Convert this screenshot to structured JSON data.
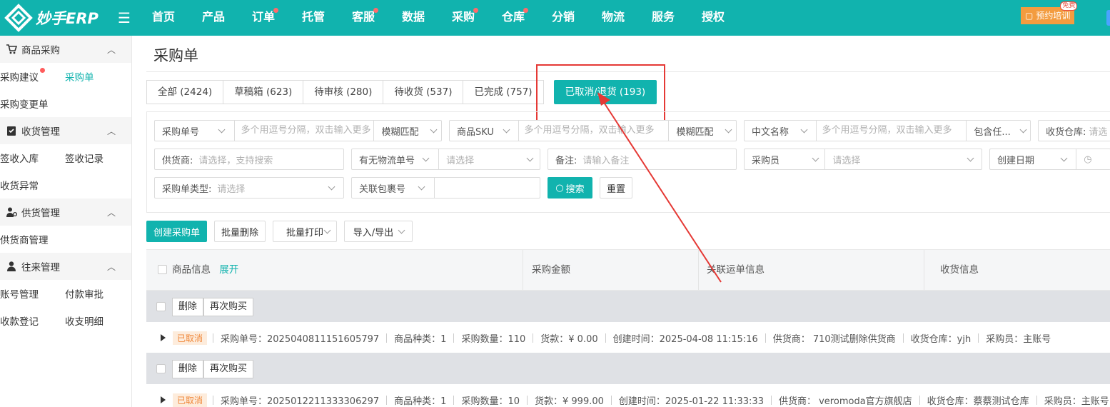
{
  "app": {
    "logo_text": "妙手ERP"
  },
  "nav": [
    {
      "label": "首页",
      "dot": false
    },
    {
      "label": "产品",
      "dot": false
    },
    {
      "label": "订单",
      "dot": true
    },
    {
      "label": "托管",
      "dot": false
    },
    {
      "label": "客服",
      "dot": true
    },
    {
      "label": "数据",
      "dot": false
    },
    {
      "label": "采购",
      "dot": true
    },
    {
      "label": "仓库",
      "dot": true
    },
    {
      "label": "分销",
      "dot": false
    },
    {
      "label": "物流",
      "dot": false
    },
    {
      "label": "服务",
      "dot": false
    },
    {
      "label": "授权",
      "dot": false
    }
  ],
  "header": {
    "training_label": "预约培训",
    "free_badge": "免费"
  },
  "sidebar": {
    "groups": [
      {
        "title": "商品采购",
        "icon": "cart-icon",
        "items": [
          [
            "采购建议",
            "采购单"
          ],
          [
            "采购变更单"
          ]
        ]
      },
      {
        "title": "收货管理",
        "icon": "clipboard-check-icon",
        "items": [
          [
            "签收入库",
            "签收记录"
          ],
          [
            "收货异常"
          ]
        ]
      },
      {
        "title": "供货管理",
        "icon": "supplier-icon",
        "items": [
          [
            "供货商管理"
          ]
        ]
      },
      {
        "title": "往来管理",
        "icon": "user-icon",
        "items": [
          [
            "账号管理",
            "付款审批"
          ],
          [
            "收款登记",
            "收支明细"
          ]
        ]
      }
    ]
  },
  "page": {
    "title": "采购单"
  },
  "tabs": [
    "全部 (2424)",
    "草稿箱 (623)",
    "待审核 (280)",
    "待收货 (537)",
    "已完成 (757)",
    "已取消/退货 (193)"
  ],
  "filters": {
    "po_no_select": "采购单号",
    "po_no_placeholder": "多个用逗号分隔，双击输入更多",
    "po_no_match": "模糊匹配",
    "sku_select": "商品SKU",
    "sku_placeholder": "多个用逗号分隔，双击输入更多",
    "sku_match": "模糊匹配",
    "cn_name_select": "中文名称",
    "cn_name_placeholder": "多个用逗号分隔，双击输入更多",
    "cn_name_match": "包含任...",
    "warehouse_label": "收货仓库:",
    "warehouse_placeholder": "请选",
    "supplier_label": "供货商:",
    "supplier_placeholder": "请选择，支持搜索",
    "tracking_select": "有无物流单号",
    "tracking_placeholder": "请选择",
    "remark_label": "备注:",
    "remark_placeholder": "请输入备注",
    "buyer_select": "采购员",
    "buyer_placeholder": "请选择",
    "date_select": "创建日期",
    "type_label": "采购单类型:",
    "type_placeholder": "请选择",
    "package_select": "关联包裹号",
    "search_button": "搜索",
    "reset_button": "重置"
  },
  "actions": {
    "create": "创建采购单",
    "batch_delete": "批量删除",
    "batch_print": "批量打印",
    "import_export": "导入/导出"
  },
  "table": {
    "headers": [
      "商品信息",
      "采购金额",
      "关联运单信息",
      "收货信息"
    ],
    "expand_label": "展开",
    "group_buttons": [
      "删除",
      "再次购买"
    ],
    "orders": [
      {
        "status": "已取消",
        "po_no": "采购单号：2025040811151605797",
        "kinds": "商品种类：1",
        "qty": "采购数量：110",
        "amount": "货款：¥ 0.00",
        "created": "创建时间：2025-04-08 11:15:16",
        "supplier": "供货商： 710测试删除供货商",
        "warehouse": "收货仓库：yjh",
        "buyer": "采购员：主账号"
      },
      {
        "status": "已取消",
        "po_no": "采购单号：2025012211333306297",
        "kinds": "商品种类：1",
        "qty": "采购数量：10",
        "amount": "货款：¥ 999.00",
        "created": "创建时间：2025-01-22 11:33:33",
        "supplier": "供货商： veromoda官方旗舰店",
        "warehouse": "收货仓库：蔡蔡测试仓库",
        "buyer": "采购员：主账号"
      }
    ]
  },
  "colors": {
    "brand": "#11b3ae",
    "alert_red": "#e53935",
    "status_orange": "#f0883a"
  }
}
